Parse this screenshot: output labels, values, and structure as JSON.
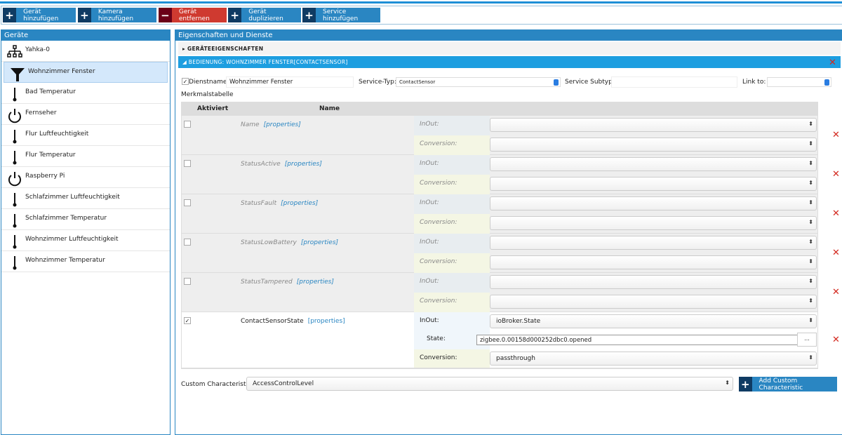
{
  "toolbar": {
    "add_device": "Gerät hinzufügen",
    "add_camera": "Kamera hinzufügen",
    "remove_device": "Gerät entfernen",
    "duplicate_device": "Gerät duplizieren",
    "add_service": "Service hinzufügen"
  },
  "devices": {
    "title": "Geräte",
    "items": [
      {
        "label": "Yahka-0",
        "icon": "network"
      },
      {
        "label": "Wohnzimmer Fenster",
        "icon": "funnel"
      },
      {
        "label": "Bad Temperatur",
        "icon": "thermometer"
      },
      {
        "label": "Fernseher",
        "icon": "power"
      },
      {
        "label": "Flur Luftfeuchtigkeit",
        "icon": "thermometer"
      },
      {
        "label": "Flur Temperatur",
        "icon": "thermometer"
      },
      {
        "label": "Raspberry Pi",
        "icon": "power"
      },
      {
        "label": "Schlafzimmer Luftfeuchtigkeit",
        "icon": "thermometer"
      },
      {
        "label": "Schlafzimmer Temperatur",
        "icon": "thermometer"
      },
      {
        "label": "Wohnzimmer Luftfeuchtigkeit",
        "icon": "thermometer"
      },
      {
        "label": "Wohnzimmer Temperatur",
        "icon": "thermometer"
      }
    ]
  },
  "props": {
    "title": "Eigenschaften und Dienste",
    "device_section": "GERÄTEEIGENSCHAFTEN",
    "service_section": "BEDIENUNG: WOHNZIMMER FENSTER[CONTACTSENSOR]",
    "service_name_label": "Dienstname:",
    "service_name": "Wohnzimmer Fenster",
    "service_type_label": "Service-Typ:",
    "service_type": "ContactSensor",
    "subtype_label": "Service Subtyp:",
    "subtype": "",
    "link_label": "Link to:",
    "link": "",
    "table_title": "Merkmalstabelle",
    "col_active": "Aktiviert",
    "col_name": "Name",
    "properties_link": "[properties]",
    "inout_label": "InOut:",
    "conversion_label": "Conversion:",
    "state_label": "State:",
    "rows": [
      {
        "name": "Name",
        "active": false
      },
      {
        "name": "StatusActive",
        "active": false
      },
      {
        "name": "StatusFault",
        "active": false
      },
      {
        "name": "StatusLowBattery",
        "active": false
      },
      {
        "name": "StatusTampered",
        "active": false
      },
      {
        "name": "ContactSensorState",
        "active": true,
        "inout": "ioBroker.State",
        "state": "zigbee.0.00158d000252dbc0.opened",
        "conversion": "passthrough"
      }
    ],
    "state_browse": "...",
    "custom_label": "Custom Characteristic",
    "custom_value": "AccessControlLevel",
    "add_custom": "Add Custom Characteristic"
  }
}
